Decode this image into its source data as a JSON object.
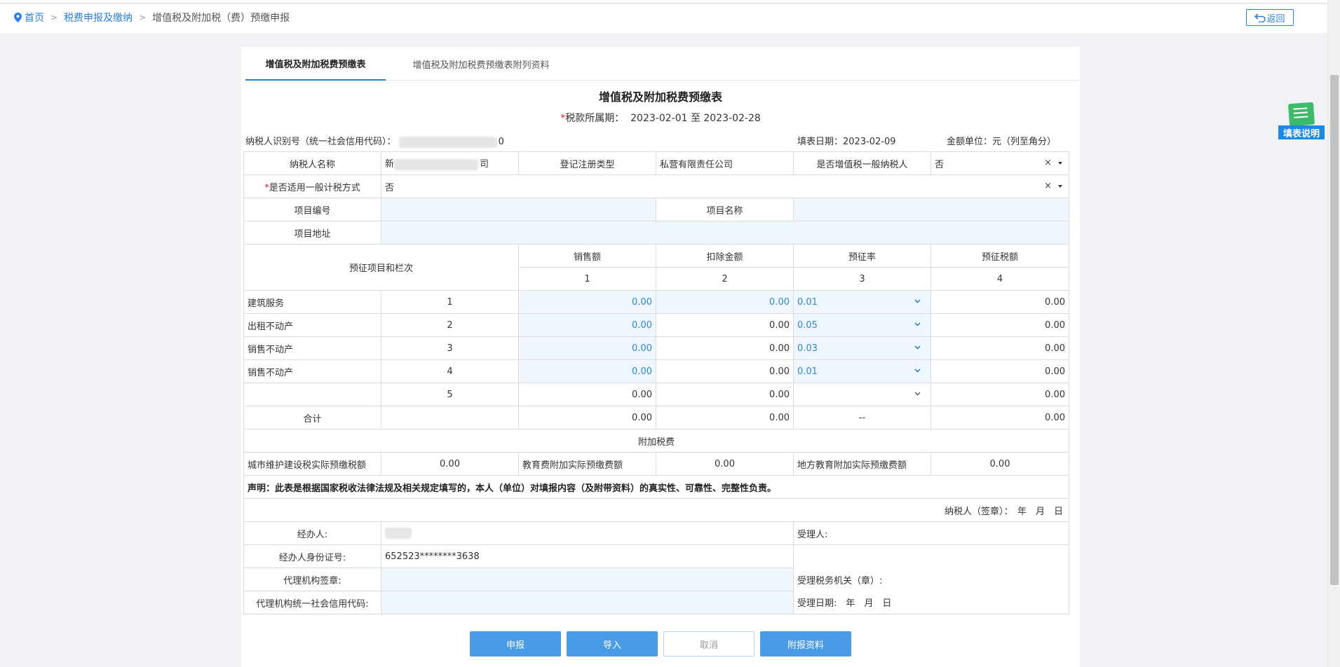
{
  "breadcrumb": {
    "home": "首页",
    "level2": "税费申报及缴纳",
    "current": "增值税及附加税（费）预缴申报",
    "separator": ">"
  },
  "header": {
    "back_label": "返回"
  },
  "help": {
    "label": "填表说明"
  },
  "tabs": [
    {
      "label": "增值税及附加税费预缴表"
    },
    {
      "label": "增值税及附加税费预缴表附列资料"
    }
  ],
  "form": {
    "title": "增值税及附加税费预缴表",
    "period_label": "税款所属期：",
    "period_value": "2023-02-01 至 2023-02-28",
    "taxpayer_id_label": "纳税人识别号（统一社会信用代码）：",
    "taxpayer_id_tail": "0",
    "fill_date": "填表日期：2023-02-09",
    "unit": "金额单位：元（列至角分）"
  },
  "basic": {
    "name_label": "纳税人名称",
    "name_prefix": "新",
    "name_suffix": "司",
    "reg_type_label": "登记注册类型",
    "reg_type_value": "私营有限责任公司",
    "general_label": "是否增值税一般纳税人",
    "general_value": "否",
    "method_label": "是否适用一般计税方式",
    "method_value": "否",
    "clear_glyph": "×",
    "project_no_label": "项目编号",
    "project_name_label": "项目名称",
    "project_addr_label": "项目地址"
  },
  "prepay": {
    "header_item": "预征项目和栏次",
    "columns": [
      {
        "label": "销售额",
        "index": "1"
      },
      {
        "label": "扣除金额",
        "index": "2"
      },
      {
        "label": "预征率",
        "index": "3"
      },
      {
        "label": "预征税额",
        "index": "4"
      }
    ],
    "rows": [
      {
        "item": "建筑服务",
        "no": "1",
        "sales": "0.00",
        "deduct": "0.00",
        "rate": "0.01",
        "tax": "0.00"
      },
      {
        "item": "出租不动产",
        "no": "2",
        "sales": "0.00",
        "deduct": "0.00",
        "rate": "0.05",
        "tax": "0.00"
      },
      {
        "item": "销售不动产",
        "no": "3",
        "sales": "0.00",
        "deduct": "0.00",
        "rate": "0.03",
        "tax": "0.00"
      },
      {
        "item": "销售不动产",
        "no": "4",
        "sales": "0.00",
        "deduct": "0.00",
        "rate": "0.01",
        "tax": "0.00"
      },
      {
        "item": "",
        "no": "5",
        "sales": "0.00",
        "deduct": "0.00",
        "rate": "",
        "tax": "0.00"
      }
    ],
    "total": {
      "label": "合计",
      "sales": "0.00",
      "deduct": "0.00",
      "rate": "--",
      "tax": "0.00"
    }
  },
  "surtax": {
    "section_label": "附加税费",
    "city_label": "城市维护建设税实际预缴税额",
    "city_value": "0.00",
    "edu_label": "教育费附加实际预缴费额",
    "edu_value": "0.00",
    "local_edu_label": "地方教育附加实际预缴费额",
    "local_edu_value": "0.00"
  },
  "declaration": {
    "text": "声明：此表是根据国家税收法律法规及相关规定填写的，本人（单位）对填报内容（及附带资料）的真实性、可靠性、完整性负责。",
    "sign": "纳税人（签章）：　年　月　日"
  },
  "agent": {
    "operator_label": "经办人:",
    "operator_id_label": "经办人身份证号:",
    "operator_id_value": "652523********3638",
    "agency_sign_label": "代理机构签章:",
    "agency_code_label": "代理机构统一社会信用代码:",
    "acceptor_label": "受理人:",
    "tax_office_label": "受理税务机关（章）:",
    "accept_date_label": "受理日期:　年　月　日"
  },
  "actions": {
    "submit": "申报",
    "import": "导入",
    "cancel": "取消",
    "attach": "附报资料"
  },
  "colors": {
    "accent": "#2a7fd9",
    "input_bg": "#f0f6fd",
    "button": "#4a9be5",
    "required": "#e02020"
  }
}
